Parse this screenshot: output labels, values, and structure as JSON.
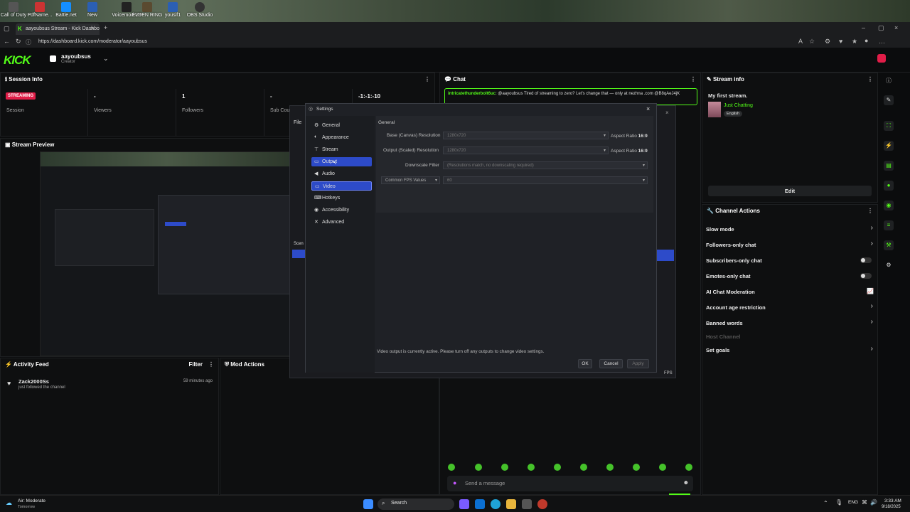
{
  "desktop": {
    "icons": [
      {
        "label": "Call of Duty",
        "color": "#555"
      },
      {
        "label": "PdfName...",
        "color": "#c33"
      },
      {
        "label": "Battle.net",
        "color": "#148eff"
      },
      {
        "label": "New",
        "color": "#2b5fb3"
      },
      {
        "label": "Voicemod V3",
        "color": "#222"
      },
      {
        "label": "ELDEN RING",
        "color": "#5a4a30"
      },
      {
        "label": "yousif1",
        "color": "#2b5fb3"
      },
      {
        "label": "OBS Studio",
        "color": "#333"
      }
    ]
  },
  "browser": {
    "tab_title": "aayoubsus Stream - Kick Dashbo",
    "url": "https://dashboard.kick.com/moderator/aayoubsus"
  },
  "kick": {
    "logo": "KICK",
    "user": {
      "name": "aayoubsus",
      "role": "Creator"
    }
  },
  "session": {
    "title": "Session Info",
    "status_badge": "STREAMING",
    "session_label": "Session",
    "stats": [
      {
        "value": "-",
        "label": "Viewers"
      },
      {
        "value": "1",
        "label": "Followers"
      },
      {
        "value": "-",
        "label": "Sub Counts"
      },
      {
        "value": "-1:-1:-10",
        "label": ""
      }
    ]
  },
  "preview": {
    "title": "Stream Preview"
  },
  "activity": {
    "title": "Activity Feed",
    "filter": "Filter",
    "item": {
      "user": "Zack2000Ss",
      "text": "just followed the channel",
      "time": "59 minutes ago"
    }
  },
  "mod_actions": {
    "title": "Mod Actions"
  },
  "chat": {
    "title": "Chat",
    "message_user": "intricatethunderbolt6uc",
    "message_text": "@aayoubsus Tired of streaming to zero? Let's change that — only at nezhna .com @B8qAeJ4jK",
    "input_placeholder": "Send a message"
  },
  "stream_info": {
    "title": "Stream info",
    "stream_title": "My first stream.",
    "category": "Just Chatting",
    "language": "English",
    "edit": "Edit"
  },
  "channel_actions": {
    "title": "Channel Actions",
    "items": [
      {
        "label": "Slow mode",
        "control": "chevron"
      },
      {
        "label": "Followers-only chat",
        "control": "chevron"
      },
      {
        "label": "Subscribers-only chat",
        "control": "toggle"
      },
      {
        "label": "Emotes-only chat",
        "control": "toggle"
      },
      {
        "label": "AI Chat Moderation",
        "control": "chart"
      },
      {
        "label": "Account age restriction",
        "control": "chevron"
      },
      {
        "label": "Banned words",
        "control": "chevron"
      },
      {
        "label": "Host Channel",
        "control": "none"
      },
      {
        "label": "Set goals",
        "control": "chevron"
      }
    ]
  },
  "obs": {
    "behind": {
      "file_menu": "File",
      "scenes": "Scen",
      "fps": "FPS"
    },
    "settings": {
      "title": "Settings",
      "sidebar": [
        "General",
        "Appearance",
        "Stream",
        "Output",
        "Audio",
        "Video",
        "Hotkeys",
        "Accessibility",
        "Advanced"
      ],
      "selected": "Video",
      "hovered": "Output",
      "section_title": "General",
      "rows": [
        {
          "label": "Base (Canvas) Resolution",
          "value": "1280x720",
          "aspect": "Aspect Ratio",
          "ratio": "16:9"
        },
        {
          "label": "Output (Scaled) Resolution",
          "value": "1280x720",
          "aspect": "Aspect Ratio",
          "ratio": "16:9"
        },
        {
          "label": "Downscale Filter",
          "value": "(Resolutions match, no downscaling required)"
        },
        {
          "label": "Common FPS Values",
          "value": "60"
        }
      ],
      "notice": "Video output is currently active. Please turn off any outputs to change video settings.",
      "buttons": {
        "ok": "OK",
        "cancel": "Cancel",
        "apply": "Apply"
      }
    }
  },
  "taskbar": {
    "weather": "Air: Moderate",
    "weather_sub": "Tomorrow",
    "search": "Search",
    "lang": "ENG",
    "time": "3:33 AM",
    "date": "9/18/2025"
  },
  "colors": {
    "kick_green": "#53fc18",
    "streaming_red": "#e11d48",
    "obs_select": "#2d4bc9"
  }
}
